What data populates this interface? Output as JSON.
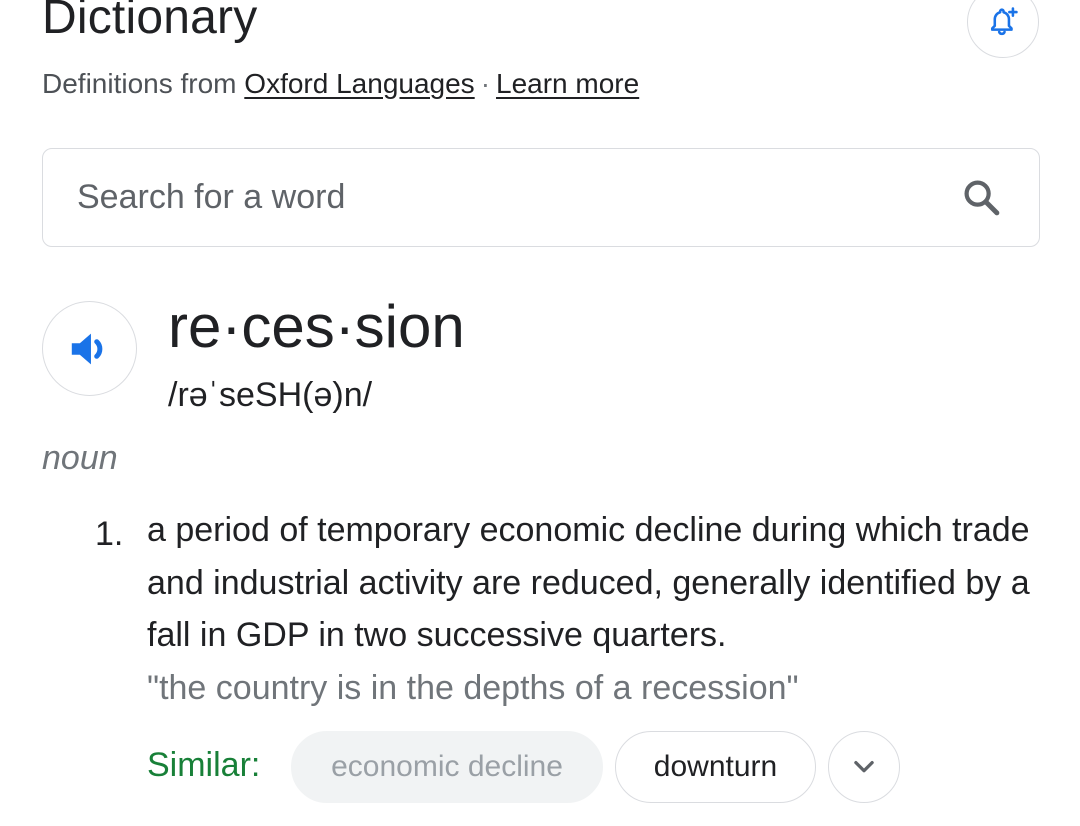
{
  "header": {
    "title": "Dictionary",
    "source_prefix": "Definitions from",
    "source_link": "Oxford Languages",
    "separator": "·",
    "learn_more": "Learn more"
  },
  "search": {
    "placeholder": "Search for a word",
    "value": ""
  },
  "entry": {
    "headword": "re·ces·sion",
    "pronunciation": "/rəˈseSH(ə)n/",
    "part_of_speech": "noun",
    "senses": [
      {
        "number": "1.",
        "definition": "a period of temporary economic decline during which trade and industrial activity are reduced, generally identified by a fall in GDP in two successive quarters.",
        "example": "\"the country is in the depths of a recession\""
      }
    ],
    "similar": {
      "label": "Similar:",
      "words": [
        "economic decline",
        "downturn"
      ]
    }
  },
  "icons": {
    "alert": "bell-plus-icon",
    "search": "search-icon",
    "audio": "speaker-icon",
    "expand": "chevron-down-icon"
  },
  "colors": {
    "accent_blue": "#1a73e8",
    "similar_green": "#188038",
    "border": "#dadce0"
  }
}
